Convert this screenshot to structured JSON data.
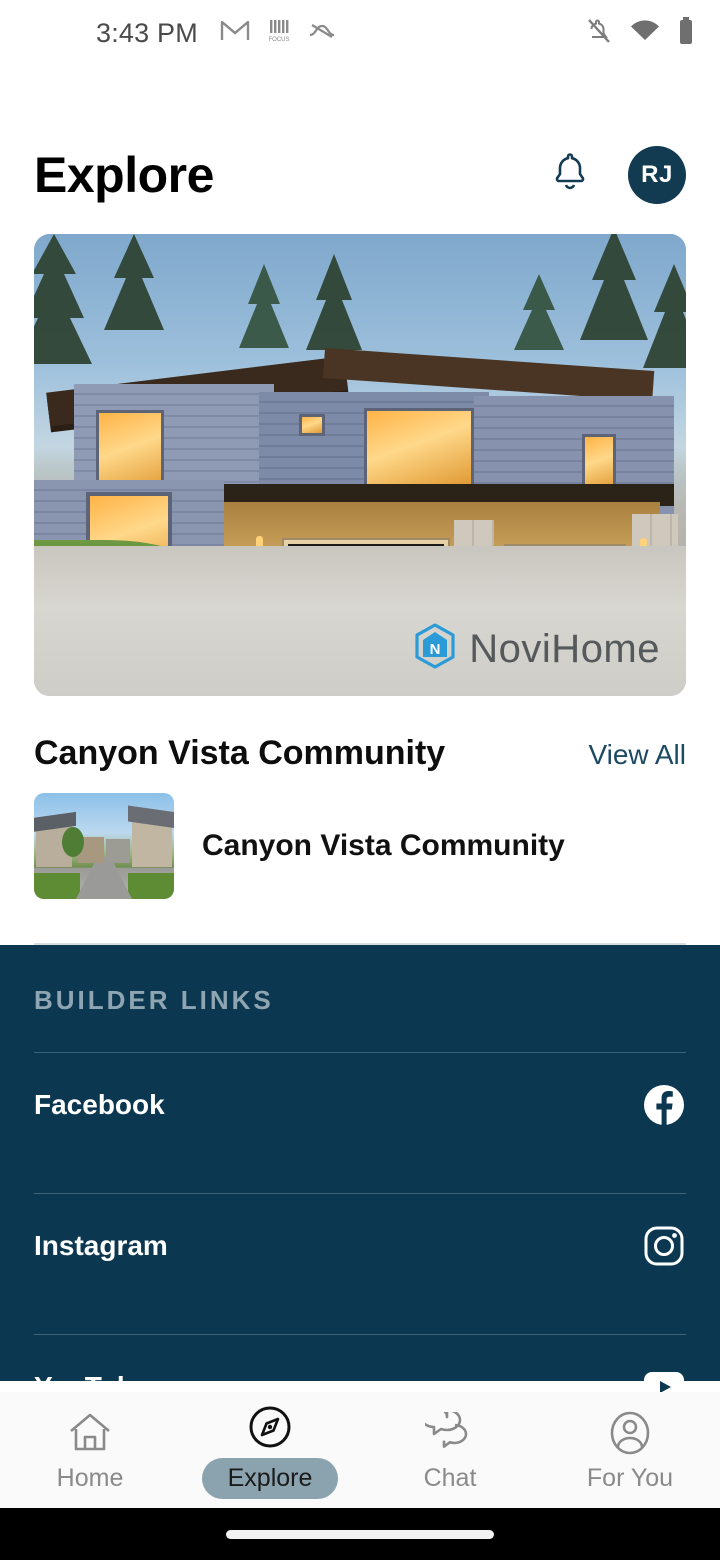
{
  "status_bar": {
    "time": "3:43 PM",
    "left_icons": [
      "gmail-icon",
      "focus-app-icon",
      "squiggle-app-icon"
    ],
    "right_icons": [
      "notifications-muted-icon",
      "wifi-icon",
      "battery-icon"
    ]
  },
  "header": {
    "title": "Explore",
    "notifications_icon": "bell-icon",
    "avatar_initials": "RJ",
    "avatar_color": "#123B52"
  },
  "hero": {
    "image_alt": "Modern two-story home exterior at dusk with lit windows and two garage doors",
    "watermark_text": "NoviHome",
    "watermark_logo": "novihome-house-n-logo",
    "logo_color": "#2B9BD8"
  },
  "section": {
    "title": "Canyon Vista Community",
    "view_all_label": "View All",
    "view_all_color": "#1c4a63",
    "items": [
      {
        "label": "Canyon Vista Community",
        "thumb_alt": "Suburban street lined with houses and green lawns"
      }
    ]
  },
  "footer": {
    "title": "BUILDER LINKS",
    "background_color": "#0B3850",
    "links": [
      {
        "label": "Facebook",
        "icon": "facebook-icon"
      },
      {
        "label": "Instagram",
        "icon": "instagram-icon"
      },
      {
        "label": "YouTube",
        "icon": "youtube-icon"
      }
    ]
  },
  "bottom_nav": {
    "active_pill_color": "#8BA3AE",
    "items": [
      {
        "label": "Home",
        "icon": "home-icon",
        "active": false
      },
      {
        "label": "Explore",
        "icon": "compass-icon",
        "active": true
      },
      {
        "label": "Chat",
        "icon": "chat-bubbles-icon",
        "active": false
      },
      {
        "label": "For You",
        "icon": "person-circle-icon",
        "active": false
      }
    ]
  }
}
